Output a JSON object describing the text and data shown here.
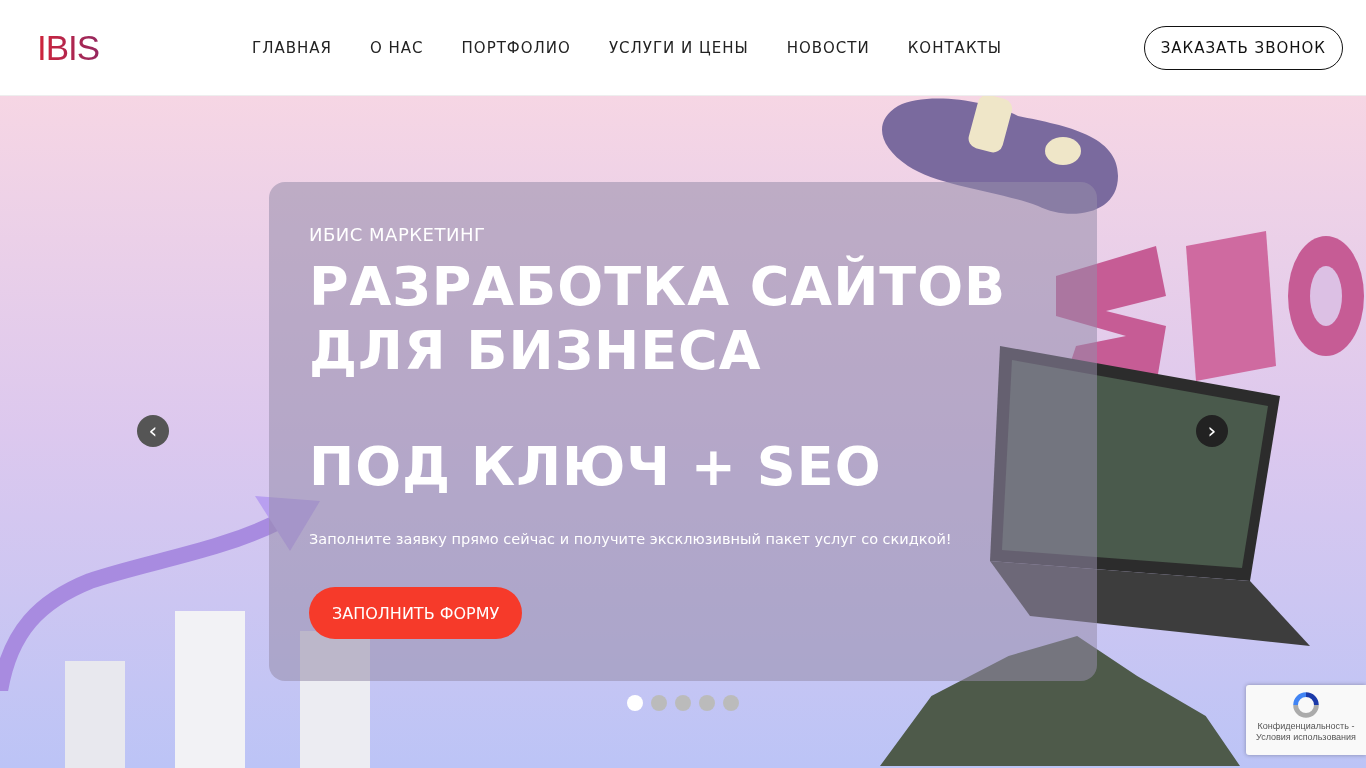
{
  "header": {
    "logo": "IBIS",
    "nav": [
      {
        "label": "ГЛАВНАЯ",
        "selected": false
      },
      {
        "label": "О НАС",
        "selected": false
      },
      {
        "label": "ПОРТФОЛИО",
        "selected": false
      },
      {
        "label": "УСЛУГИ И ЦЕНЫ",
        "selected": false
      },
      {
        "label": "НОВОСТИ",
        "selected": false
      },
      {
        "label": "КОНТАКТЫ",
        "selected": false
      }
    ],
    "cta": "ЗАКАЗАТЬ ЗВОНОК"
  },
  "hero": {
    "prev": "‹",
    "next": "›",
    "eyebrow": "ИБИС МАРКЕТИНГ",
    "title_lines": [
      "РАЗРАБОТКА САЙТОВ",
      "ДЛЯ БИЗНЕСА",
      "ПОД КЛЮЧ + SEO"
    ],
    "subtitle": "Заполните заявку прямо сейчас и получите эксклюзивный пакет услуг со скидкой!",
    "button": "ЗАПОЛНИТЬ ФОРМУ",
    "dots": [
      {
        "selected": true
      },
      {
        "selected": false
      },
      {
        "selected": false
      },
      {
        "selected": false
      },
      {
        "selected": false
      }
    ]
  },
  "recaptcha": {
    "legal": "Конфиденциальность - Условия использования"
  }
}
